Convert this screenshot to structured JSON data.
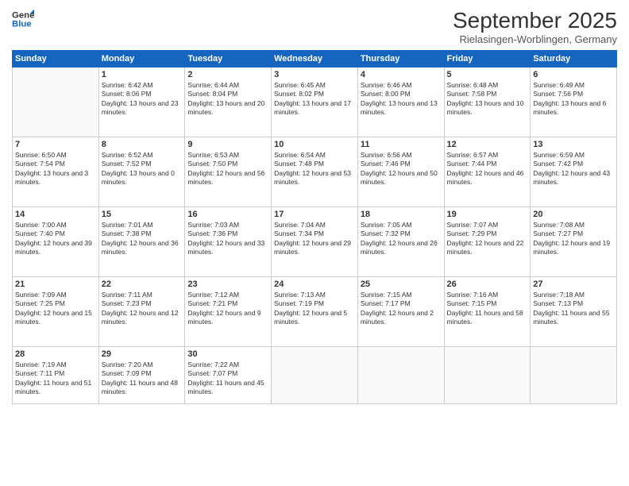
{
  "logo": {
    "line1": "General",
    "line2": "Blue"
  },
  "title": "September 2025",
  "subtitle": "Rielasingen-Worblingen, Germany",
  "days_of_week": [
    "Sunday",
    "Monday",
    "Tuesday",
    "Wednesday",
    "Thursday",
    "Friday",
    "Saturday"
  ],
  "weeks": [
    [
      {
        "day": "",
        "content": ""
      },
      {
        "day": "1",
        "content": "Sunrise: 6:42 AM\nSunset: 8:06 PM\nDaylight: 13 hours and 23 minutes."
      },
      {
        "day": "2",
        "content": "Sunrise: 6:44 AM\nSunset: 8:04 PM\nDaylight: 13 hours and 20 minutes."
      },
      {
        "day": "3",
        "content": "Sunrise: 6:45 AM\nSunset: 8:02 PM\nDaylight: 13 hours and 17 minutes."
      },
      {
        "day": "4",
        "content": "Sunrise: 6:46 AM\nSunset: 8:00 PM\nDaylight: 13 hours and 13 minutes."
      },
      {
        "day": "5",
        "content": "Sunrise: 6:48 AM\nSunset: 7:58 PM\nDaylight: 13 hours and 10 minutes."
      },
      {
        "day": "6",
        "content": "Sunrise: 6:49 AM\nSunset: 7:56 PM\nDaylight: 13 hours and 6 minutes."
      }
    ],
    [
      {
        "day": "7",
        "content": "Sunrise: 6:50 AM\nSunset: 7:54 PM\nDaylight: 13 hours and 3 minutes."
      },
      {
        "day": "8",
        "content": "Sunrise: 6:52 AM\nSunset: 7:52 PM\nDaylight: 13 hours and 0 minutes."
      },
      {
        "day": "9",
        "content": "Sunrise: 6:53 AM\nSunset: 7:50 PM\nDaylight: 12 hours and 56 minutes."
      },
      {
        "day": "10",
        "content": "Sunrise: 6:54 AM\nSunset: 7:48 PM\nDaylight: 12 hours and 53 minutes."
      },
      {
        "day": "11",
        "content": "Sunrise: 6:56 AM\nSunset: 7:46 PM\nDaylight: 12 hours and 50 minutes."
      },
      {
        "day": "12",
        "content": "Sunrise: 6:57 AM\nSunset: 7:44 PM\nDaylight: 12 hours and 46 minutes."
      },
      {
        "day": "13",
        "content": "Sunrise: 6:59 AM\nSunset: 7:42 PM\nDaylight: 12 hours and 43 minutes."
      }
    ],
    [
      {
        "day": "14",
        "content": "Sunrise: 7:00 AM\nSunset: 7:40 PM\nDaylight: 12 hours and 39 minutes."
      },
      {
        "day": "15",
        "content": "Sunrise: 7:01 AM\nSunset: 7:38 PM\nDaylight: 12 hours and 36 minutes."
      },
      {
        "day": "16",
        "content": "Sunrise: 7:03 AM\nSunset: 7:36 PM\nDaylight: 12 hours and 33 minutes."
      },
      {
        "day": "17",
        "content": "Sunrise: 7:04 AM\nSunset: 7:34 PM\nDaylight: 12 hours and 29 minutes."
      },
      {
        "day": "18",
        "content": "Sunrise: 7:05 AM\nSunset: 7:32 PM\nDaylight: 12 hours and 26 minutes."
      },
      {
        "day": "19",
        "content": "Sunrise: 7:07 AM\nSunset: 7:29 PM\nDaylight: 12 hours and 22 minutes."
      },
      {
        "day": "20",
        "content": "Sunrise: 7:08 AM\nSunset: 7:27 PM\nDaylight: 12 hours and 19 minutes."
      }
    ],
    [
      {
        "day": "21",
        "content": "Sunrise: 7:09 AM\nSunset: 7:25 PM\nDaylight: 12 hours and 15 minutes."
      },
      {
        "day": "22",
        "content": "Sunrise: 7:11 AM\nSunset: 7:23 PM\nDaylight: 12 hours and 12 minutes."
      },
      {
        "day": "23",
        "content": "Sunrise: 7:12 AM\nSunset: 7:21 PM\nDaylight: 12 hours and 9 minutes."
      },
      {
        "day": "24",
        "content": "Sunrise: 7:13 AM\nSunset: 7:19 PM\nDaylight: 12 hours and 5 minutes."
      },
      {
        "day": "25",
        "content": "Sunrise: 7:15 AM\nSunset: 7:17 PM\nDaylight: 12 hours and 2 minutes."
      },
      {
        "day": "26",
        "content": "Sunrise: 7:16 AM\nSunset: 7:15 PM\nDaylight: 11 hours and 58 minutes."
      },
      {
        "day": "27",
        "content": "Sunrise: 7:18 AM\nSunset: 7:13 PM\nDaylight: 11 hours and 55 minutes."
      }
    ],
    [
      {
        "day": "28",
        "content": "Sunrise: 7:19 AM\nSunset: 7:11 PM\nDaylight: 11 hours and 51 minutes."
      },
      {
        "day": "29",
        "content": "Sunrise: 7:20 AM\nSunset: 7:09 PM\nDaylight: 11 hours and 48 minutes."
      },
      {
        "day": "30",
        "content": "Sunrise: 7:22 AM\nSunset: 7:07 PM\nDaylight: 11 hours and 45 minutes."
      },
      {
        "day": "",
        "content": ""
      },
      {
        "day": "",
        "content": ""
      },
      {
        "day": "",
        "content": ""
      },
      {
        "day": "",
        "content": ""
      }
    ]
  ]
}
